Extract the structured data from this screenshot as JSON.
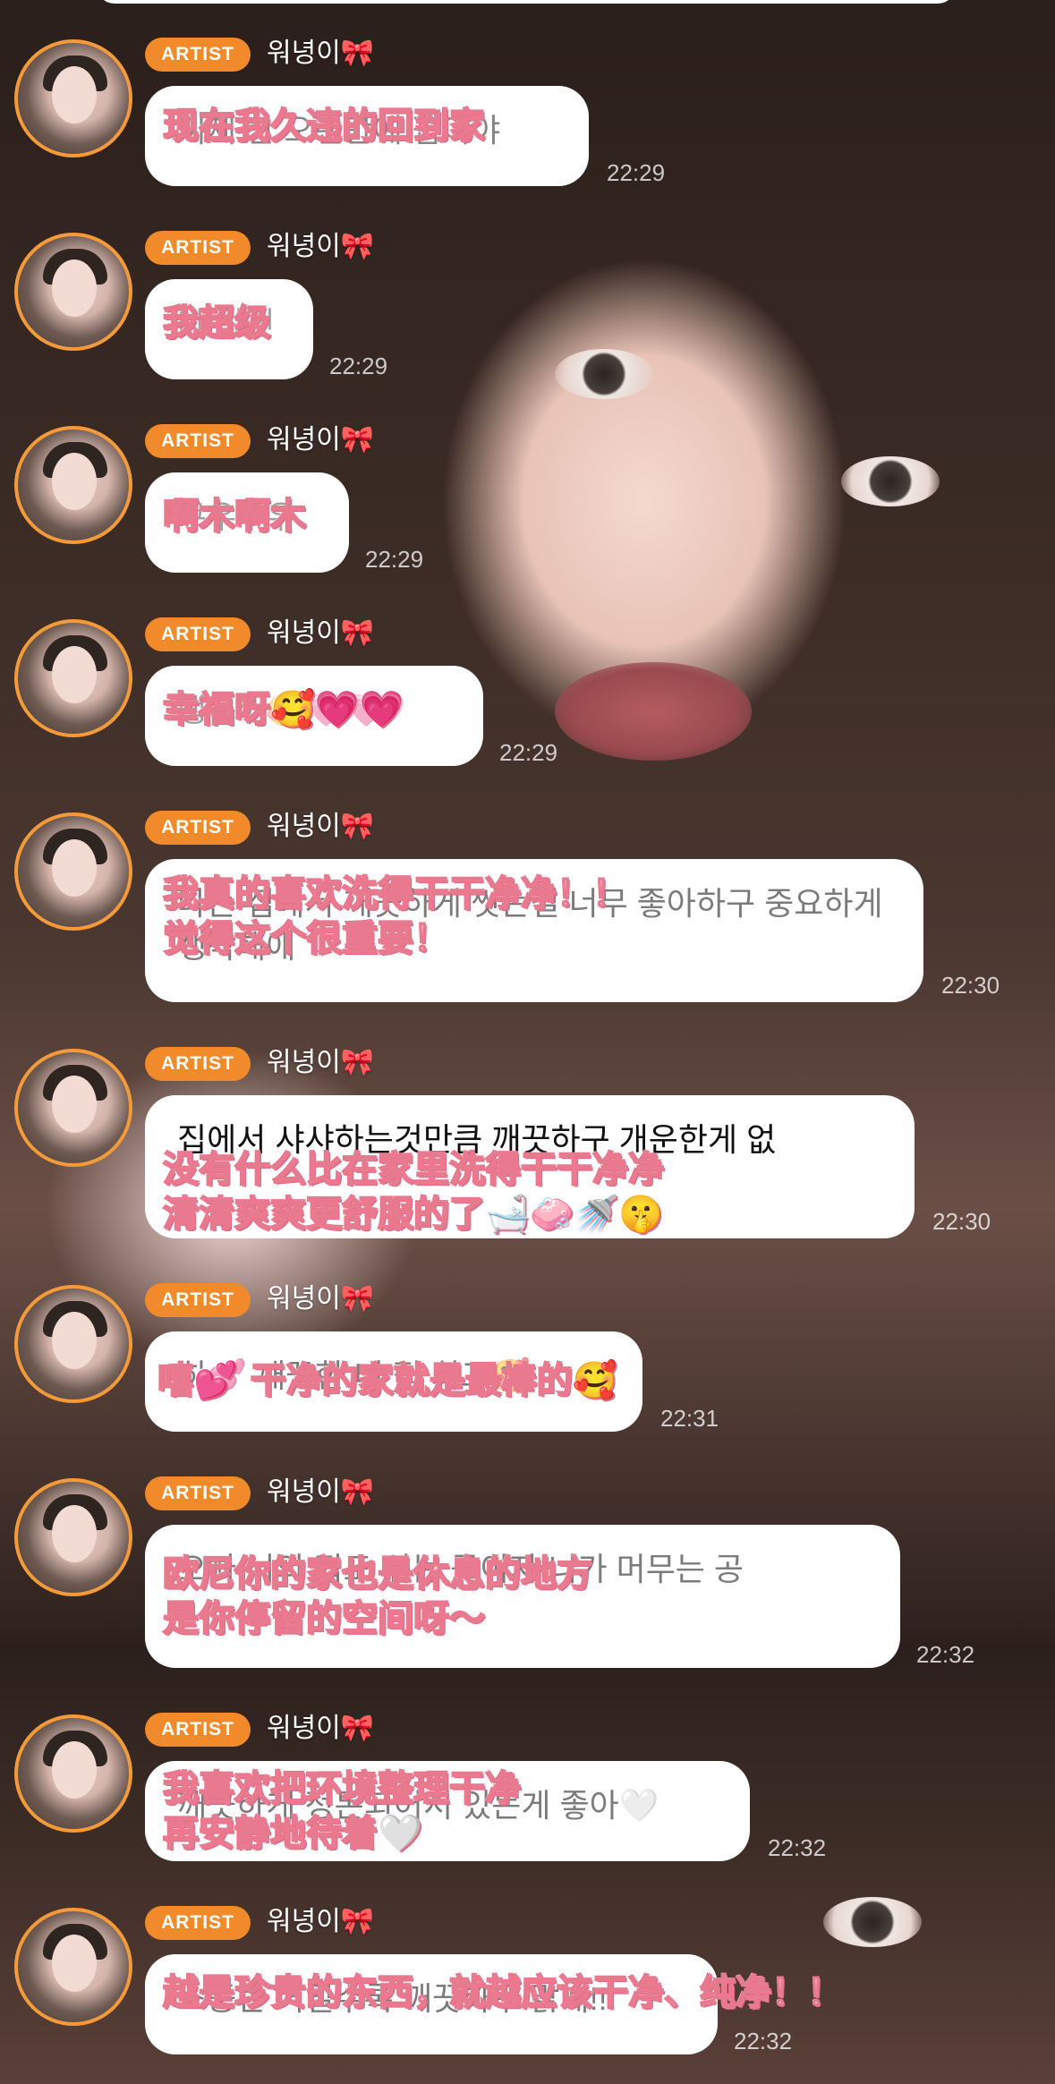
{
  "artist_badge": "ARTIST",
  "sender_name": "워녕이🎀",
  "messages": [
    {
      "korean": "이제 잔 오랜만에 집이야",
      "overlay": [
        "现在我久违的回到家"
      ],
      "time": "22:29"
    },
    {
      "korean": "나 완전",
      "overlay": [
        "我超级"
      ],
      "time": "22:29"
    },
    {
      "korean": "쿠우쿠우",
      "overlay": [
        "啊木啊木"
      ],
      "time": "22:29"
    },
    {
      "korean": "행복해🥰💗💗",
      "overlay": [
        "幸福呀🥰💗💗"
      ],
      "time": "22:29"
    },
    {
      "korean": "나는 집에서 깨끗하게 씻는걸 너무 좋아하구 중요하게 생각해애",
      "overlay": [
        "我真的喜欢洗得干干净净！！",
        "觉得这个很重要！"
      ],
      "time": "22:30"
    },
    {
      "korean": "집에서 샤샤하는것만큼 깨끗하구 개운한게 없",
      "overlay": [
        "没有什么比在家里洗得干干净净",
        "清清爽爽更舒服的了🛁🧼🚿🤫"
      ],
      "time": "22:30"
    },
    {
      "korean": "히💕 깨끗한 내 집 최고🥰",
      "overlay": [
        "嘻💕 干净的家就是最棒的🥰"
      ],
      "time": "22:31"
    },
    {
      "korean": "오빠 너의 집도 쉬는 곳이자 너가 머무는 공",
      "overlay": [
        "欧尼你的家也是休息的地方",
        "是你停留的空间呀～"
      ],
      "time": "22:32"
    },
    {
      "korean": "깨끗하게 정돈되어서 있는게 좋아🤍",
      "overlay": [
        "我喜欢把环境整理干净",
        "再安静地待着🤍"
      ],
      "time": "22:32"
    },
    {
      "korean": "소중한 거일수록 깨끗하구 맑게!!",
      "overlay": [
        "越是珍贵的东西，就越应该干净、纯净！！"
      ],
      "time": "22:32"
    }
  ]
}
